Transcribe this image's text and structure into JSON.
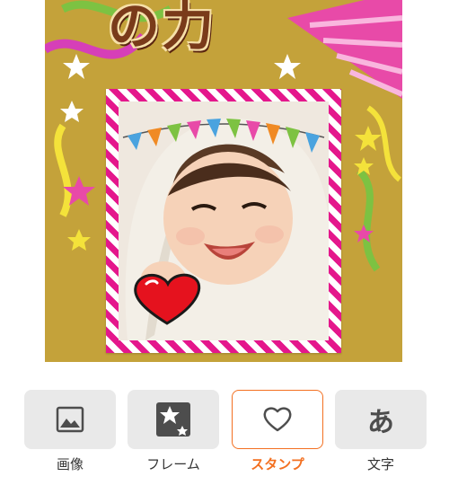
{
  "canvas": {
    "title_text": "の力",
    "background_color": "#c4a23a",
    "frame_stripe_color": "#e4178c",
    "sticker": "heart-sticker"
  },
  "toolbar": {
    "accent_color": "#f37021",
    "items": [
      {
        "label": "画像",
        "icon": "image-icon",
        "active": false
      },
      {
        "label": "フレーム",
        "icon": "frame-icon",
        "active": false
      },
      {
        "label": "スタンプ",
        "icon": "heart-icon",
        "active": true
      },
      {
        "label": "文字",
        "icon_text": "あ",
        "active": false
      }
    ]
  }
}
